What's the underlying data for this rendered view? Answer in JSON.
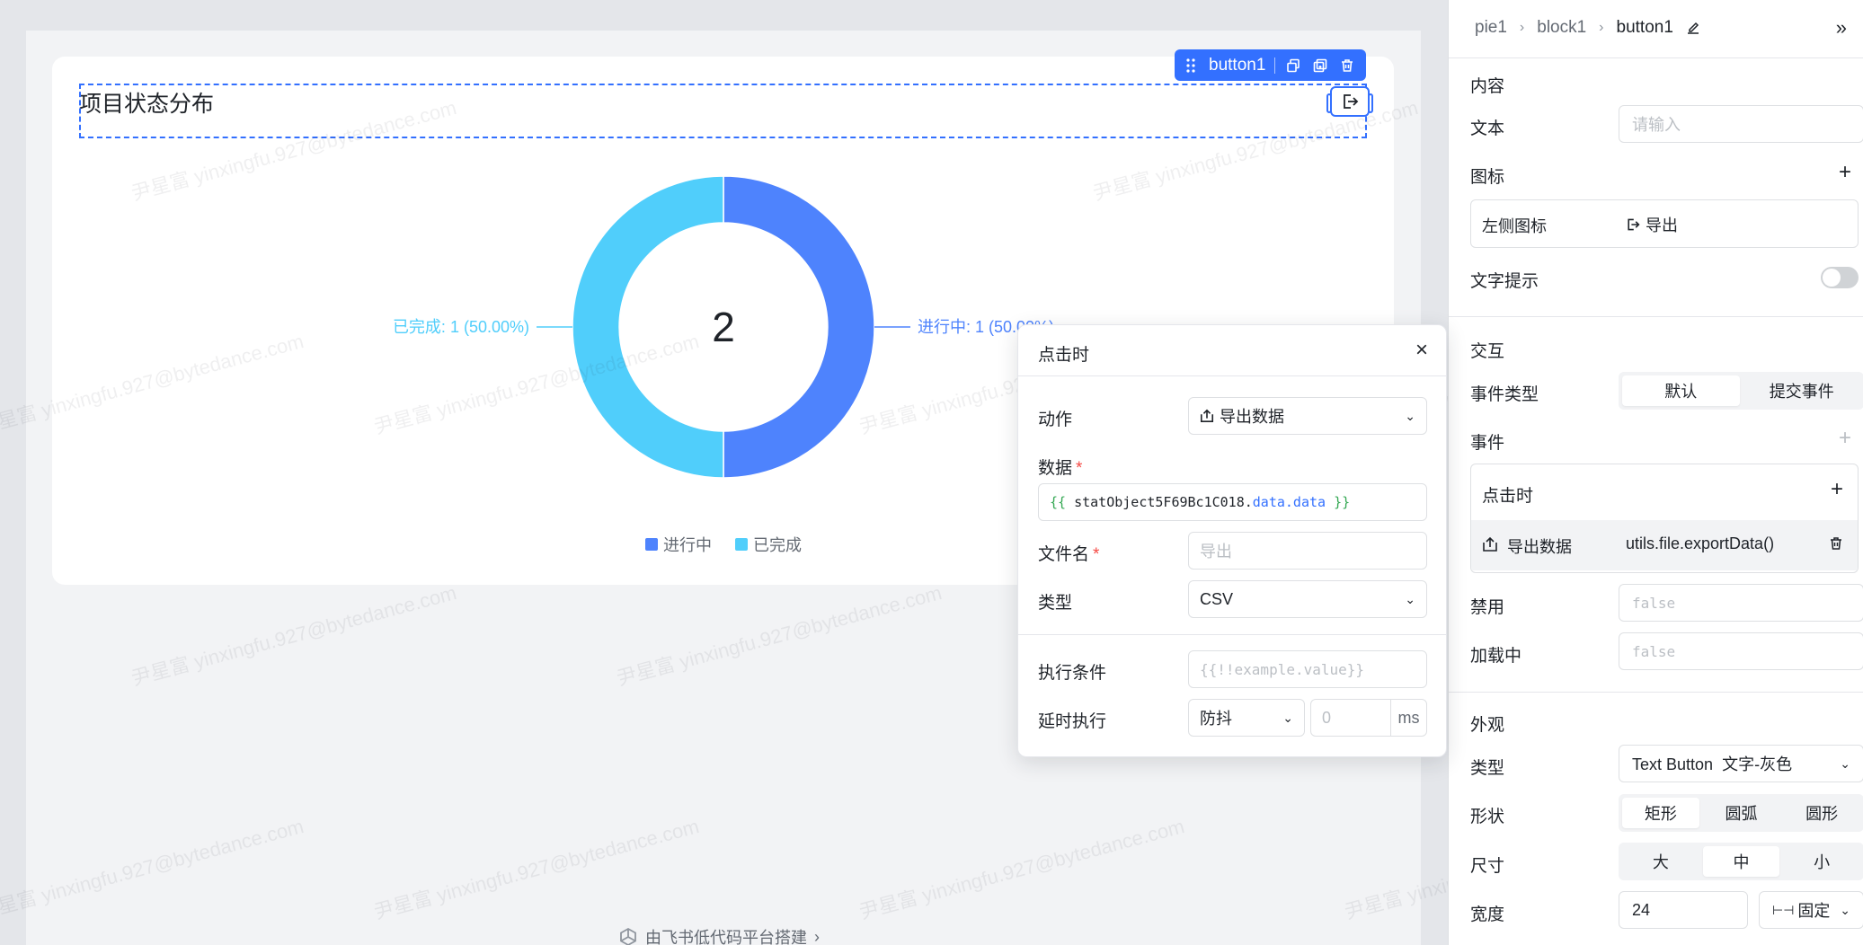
{
  "card": {
    "title": "项目状态分布"
  },
  "selection": {
    "component_name": "button1"
  },
  "chart_data": {
    "type": "pie",
    "donut": true,
    "center_value": "2",
    "categories": [
      "进行中",
      "已完成"
    ],
    "values": [
      1,
      1
    ],
    "labels": [
      "进行中: 1 (50.00%)",
      "已完成: 1 (50.00%)"
    ],
    "colors": [
      "#4e83fd",
      "#50cefb"
    ],
    "legend": [
      "进行中",
      "已完成"
    ],
    "legend_position": "bottom"
  },
  "footer": {
    "link_text": "由飞书低代码平台搭建"
  },
  "panel": {
    "breadcrumb": [
      "pie1",
      "block1",
      "button1"
    ],
    "content_section": "内容",
    "text_label": "文本",
    "text_placeholder": "请输入",
    "icon_label": "图标",
    "left_icon_label": "左侧图标",
    "left_icon_value": "导出",
    "tooltip_label": "文字提示",
    "interaction_section": "交互",
    "event_type_label": "事件类型",
    "event_type_options": [
      "默认",
      "提交事件"
    ],
    "events_label": "事件",
    "on_click_label": "点击时",
    "event_action_name": "导出数据",
    "event_action_fn": "utils.file.exportData()",
    "disabled_label": "禁用",
    "disabled_value": "false",
    "loading_label": "加载中",
    "loading_value": "false",
    "appearance_section": "外观",
    "type_label": "类型",
    "type_value_main": "Text Button",
    "type_value_sub": "文字-灰色",
    "shape_label": "形状",
    "shape_options": [
      "矩形",
      "圆弧",
      "圆形"
    ],
    "size_label": "尺寸",
    "size_options": [
      "大",
      "中",
      "小"
    ],
    "width_label": "宽度",
    "width_value": "24",
    "width_mode": "固定"
  },
  "popover": {
    "title": "点击时",
    "action_label": "动作",
    "action_value": "导出数据",
    "data_label": "数据",
    "data_expr_open": "{{",
    "data_expr_id": "statObject5F69Bc1C018.",
    "data_expr_prop": "data.data",
    "data_expr_close": "}}",
    "filename_label": "文件名",
    "filename_placeholder": "导出",
    "type_label": "类型",
    "type_value": "CSV",
    "condition_label": "执行条件",
    "condition_placeholder": "{{!!example.value}}",
    "delay_label": "延时执行",
    "delay_mode": "防抖",
    "delay_placeholder": "0",
    "delay_unit": "ms"
  },
  "watermark": "尹星富 yinxingfu.927@bytedance.com"
}
